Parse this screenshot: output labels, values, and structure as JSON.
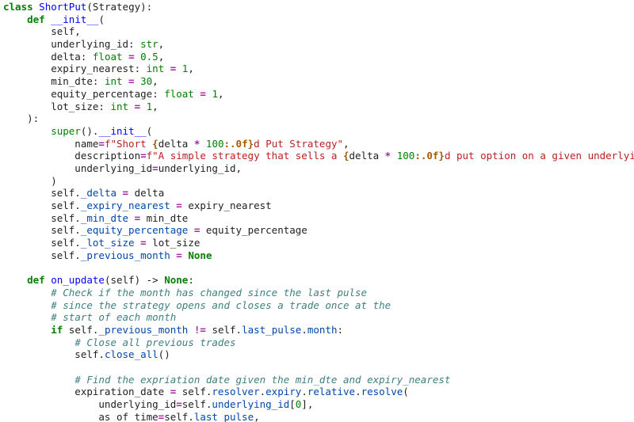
{
  "editor": {
    "language": "python",
    "lines": [
      [
        [
          "kw",
          "class"
        ],
        [
          "plain",
          " "
        ],
        [
          "cls",
          "ShortPut"
        ],
        [
          "plain",
          "(Strategy):"
        ]
      ],
      [
        [
          "plain",
          "    "
        ],
        [
          "kw",
          "def"
        ],
        [
          "plain",
          " "
        ],
        [
          "fn",
          "__init__"
        ],
        [
          "plain",
          "("
        ]
      ],
      [
        [
          "plain",
          "        self,"
        ]
      ],
      [
        [
          "plain",
          "        underlying_id: "
        ],
        [
          "bi",
          "str"
        ],
        [
          "plain",
          ","
        ]
      ],
      [
        [
          "plain",
          "        delta: "
        ],
        [
          "bi",
          "float"
        ],
        [
          "plain",
          " "
        ],
        [
          "op",
          "="
        ],
        [
          "plain",
          " "
        ],
        [
          "num",
          "0.5"
        ],
        [
          "plain",
          ","
        ]
      ],
      [
        [
          "plain",
          "        expiry_nearest: "
        ],
        [
          "bi",
          "int"
        ],
        [
          "plain",
          " "
        ],
        [
          "op",
          "="
        ],
        [
          "plain",
          " "
        ],
        [
          "num",
          "1"
        ],
        [
          "plain",
          ","
        ]
      ],
      [
        [
          "plain",
          "        min_dte: "
        ],
        [
          "bi",
          "int"
        ],
        [
          "plain",
          " "
        ],
        [
          "op",
          "="
        ],
        [
          "plain",
          " "
        ],
        [
          "num",
          "30"
        ],
        [
          "plain",
          ","
        ]
      ],
      [
        [
          "plain",
          "        equity_percentage: "
        ],
        [
          "bi",
          "float"
        ],
        [
          "plain",
          " "
        ],
        [
          "op",
          "="
        ],
        [
          "plain",
          " "
        ],
        [
          "num",
          "1"
        ],
        [
          "plain",
          ","
        ]
      ],
      [
        [
          "plain",
          "        lot_size: "
        ],
        [
          "bi",
          "int"
        ],
        [
          "plain",
          " "
        ],
        [
          "op",
          "="
        ],
        [
          "plain",
          " "
        ],
        [
          "num",
          "1"
        ],
        [
          "plain",
          ","
        ]
      ],
      [
        [
          "plain",
          "    ):"
        ]
      ],
      [
        [
          "plain",
          "        "
        ],
        [
          "bi",
          "super"
        ],
        [
          "plain",
          "()."
        ],
        [
          "fn",
          "__init__"
        ],
        [
          "plain",
          "("
        ]
      ],
      [
        [
          "plain",
          "            name"
        ],
        [
          "op",
          "="
        ],
        [
          "str",
          "f\"Short "
        ],
        [
          "fs",
          "{"
        ],
        [
          "plain",
          "delta "
        ],
        [
          "op",
          "*"
        ],
        [
          "plain",
          " "
        ],
        [
          "num",
          "100"
        ],
        [
          "fs",
          ":.0f}"
        ],
        [
          "str",
          "d Put Strategy\""
        ],
        [
          "plain",
          ","
        ]
      ],
      [
        [
          "plain",
          "            description"
        ],
        [
          "op",
          "="
        ],
        [
          "str",
          "f\"A simple strategy that sells a "
        ],
        [
          "fs",
          "{"
        ],
        [
          "plain",
          "delta "
        ],
        [
          "op",
          "*"
        ],
        [
          "plain",
          " "
        ],
        [
          "num",
          "100"
        ],
        [
          "fs",
          ":.0f}"
        ],
        [
          "str",
          "d put option on a given underlying asset.\""
        ],
        [
          "plain",
          ","
        ]
      ],
      [
        [
          "plain",
          "            underlying_id"
        ],
        [
          "op",
          "="
        ],
        [
          "plain",
          "underlying_id,"
        ]
      ],
      [
        [
          "plain",
          "        )"
        ]
      ],
      [
        [
          "plain",
          "        self."
        ],
        [
          "attr",
          "_delta"
        ],
        [
          "plain",
          " "
        ],
        [
          "op",
          "="
        ],
        [
          "plain",
          " delta"
        ]
      ],
      [
        [
          "plain",
          "        self."
        ],
        [
          "attr",
          "_expiry_nearest"
        ],
        [
          "plain",
          " "
        ],
        [
          "op",
          "="
        ],
        [
          "plain",
          " expiry_nearest"
        ]
      ],
      [
        [
          "plain",
          "        self."
        ],
        [
          "attr",
          "_min_dte"
        ],
        [
          "plain",
          " "
        ],
        [
          "op",
          "="
        ],
        [
          "plain",
          " min_dte"
        ]
      ],
      [
        [
          "plain",
          "        self."
        ],
        [
          "attr",
          "_equity_percentage"
        ],
        [
          "plain",
          " "
        ],
        [
          "op",
          "="
        ],
        [
          "plain",
          " equity_percentage"
        ]
      ],
      [
        [
          "plain",
          "        self."
        ],
        [
          "attr",
          "_lot_size"
        ],
        [
          "plain",
          " "
        ],
        [
          "op",
          "="
        ],
        [
          "plain",
          " lot_size"
        ]
      ],
      [
        [
          "plain",
          "        self."
        ],
        [
          "attr",
          "_previous_month"
        ],
        [
          "plain",
          " "
        ],
        [
          "op",
          "="
        ],
        [
          "plain",
          " "
        ],
        [
          "kw",
          "None"
        ]
      ],
      [
        [
          "plain",
          ""
        ]
      ],
      [
        [
          "plain",
          "    "
        ],
        [
          "kw",
          "def"
        ],
        [
          "plain",
          " "
        ],
        [
          "fn",
          "on_update"
        ],
        [
          "plain",
          "(self) -> "
        ],
        [
          "kw",
          "None"
        ],
        [
          "plain",
          ":"
        ]
      ],
      [
        [
          "plain",
          "        "
        ],
        [
          "cmt",
          "# Check if the month has changed since the last pulse"
        ]
      ],
      [
        [
          "plain",
          "        "
        ],
        [
          "cmt",
          "# since the strategy opens and closes a trade once at the"
        ]
      ],
      [
        [
          "plain",
          "        "
        ],
        [
          "cmt",
          "# start of each month"
        ]
      ],
      [
        [
          "plain",
          "        "
        ],
        [
          "kw",
          "if"
        ],
        [
          "plain",
          " self."
        ],
        [
          "attr",
          "_previous_month"
        ],
        [
          "plain",
          " "
        ],
        [
          "op",
          "!="
        ],
        [
          "plain",
          " self."
        ],
        [
          "attr",
          "last_pulse"
        ],
        [
          "plain",
          "."
        ],
        [
          "attr",
          "month"
        ],
        [
          "plain",
          ":"
        ]
      ],
      [
        [
          "plain",
          "            "
        ],
        [
          "cmt",
          "# Close all previous trades"
        ]
      ],
      [
        [
          "plain",
          "            self."
        ],
        [
          "attr",
          "close_all"
        ],
        [
          "plain",
          "()"
        ]
      ],
      [
        [
          "plain",
          ""
        ]
      ],
      [
        [
          "plain",
          "            "
        ],
        [
          "cmt",
          "# Find the expriation date given the min_dte and expiry_nearest"
        ]
      ],
      [
        [
          "plain",
          "            expiration_date "
        ],
        [
          "op",
          "="
        ],
        [
          "plain",
          " self."
        ],
        [
          "attr",
          "resolver"
        ],
        [
          "plain",
          "."
        ],
        [
          "attr",
          "expiry"
        ],
        [
          "plain",
          "."
        ],
        [
          "attr",
          "relative"
        ],
        [
          "plain",
          "."
        ],
        [
          "attr",
          "resolve"
        ],
        [
          "plain",
          "("
        ]
      ],
      [
        [
          "plain",
          "                underlying_id"
        ],
        [
          "op",
          "="
        ],
        [
          "plain",
          "self."
        ],
        [
          "attr",
          "underlying_id"
        ],
        [
          "plain",
          "["
        ],
        [
          "num",
          "0"
        ],
        [
          "plain",
          "],"
        ]
      ],
      [
        [
          "plain",
          "                as_of_time"
        ],
        [
          "op",
          "="
        ],
        [
          "plain",
          "self."
        ],
        [
          "attr",
          "last_pulse"
        ],
        [
          "plain",
          ","
        ]
      ]
    ]
  }
}
